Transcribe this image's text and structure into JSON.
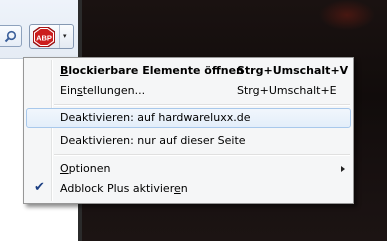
{
  "menu": {
    "items": [
      {
        "label_pre": "",
        "accel": "B",
        "label_post": "lockierbare Elemente öffnen",
        "shortcut": "Strg+Umschalt+V",
        "bold": true
      },
      {
        "label_pre": "Ein",
        "accel": "s",
        "label_post": "tellungen...",
        "shortcut": "Strg+Umschalt+E"
      },
      {
        "label": "Deaktivieren: auf hardwareluxx.de",
        "highlighted": true
      },
      {
        "label": "Deaktivieren: nur auf dieser Seite"
      },
      {
        "label_pre": "",
        "accel": "O",
        "label_post": "ptionen",
        "has_submenu": true
      },
      {
        "label_pre": "Adblock Plus aktivier",
        "accel": "e",
        "label_post": "n",
        "checked": true
      }
    ]
  },
  "toolbar": {
    "abp_text": "ABP",
    "abp_color": "#cc1d1d",
    "dropdown_glyph": "▾",
    "search_icon": "magnifier-icon",
    "checkmark": "✔"
  }
}
